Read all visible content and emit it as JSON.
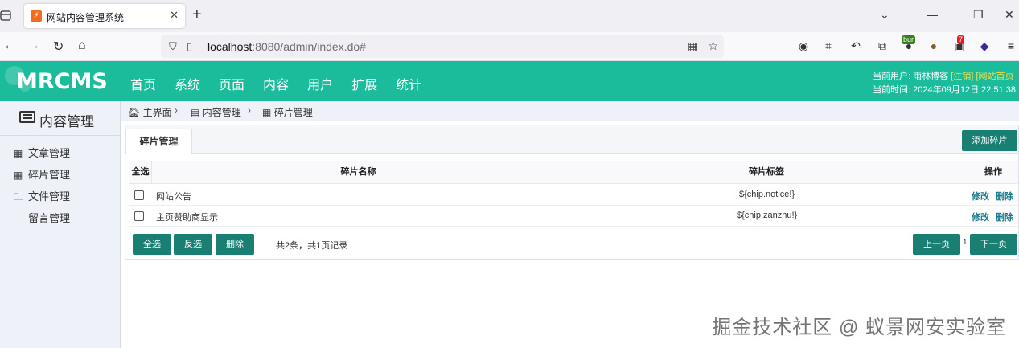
{
  "browser": {
    "tab_title": "网站内容管理系统",
    "url_host": "localhost",
    "url_rest": ":8080/admin/index.do#",
    "ext_badge_1": "bur",
    "ext_badge_2": "7"
  },
  "header": {
    "logo": "MRCMS",
    "nav": [
      "首页",
      "系统",
      "页面",
      "内容",
      "用户",
      "扩展",
      "统计"
    ],
    "user_label": "当前用户: 雨林博客",
    "logout": "[注销]",
    "site_home": "[网站首页",
    "time_label": "当前时间: 2024年09月12日 22:51:38"
  },
  "sidebar": {
    "title": "内容管理",
    "items": [
      {
        "label": "文章管理",
        "icon": "grid-icon"
      },
      {
        "label": "碎片管理",
        "icon": "grid-icon"
      },
      {
        "label": "文件管理",
        "icon": "folder-icon"
      },
      {
        "label": "留言管理",
        "icon": ""
      }
    ]
  },
  "breadcrumb": {
    "home": "主界面",
    "section": "内容管理",
    "current": "碎片管理"
  },
  "panel": {
    "tab": "碎片管理",
    "add_button": "添加碎片",
    "columns": [
      "全选",
      "碎片名称",
      "碎片标签",
      "操作"
    ],
    "rows": [
      {
        "name": "网站公告",
        "tag": "${chip.notice!}",
        "edit": "修改",
        "delete": "删除"
      },
      {
        "name": "主页赞助商显示",
        "tag": "${chip.zanzhu!}",
        "edit": "修改",
        "delete": "删除"
      }
    ],
    "select_all": "全选",
    "invert": "反选",
    "delete": "删除",
    "summary": "共2条，共1页记录",
    "prev": "上一页",
    "page": "1",
    "next": "下一页"
  },
  "watermark": "掘金技术社区 @ 蚁景网安实验室"
}
